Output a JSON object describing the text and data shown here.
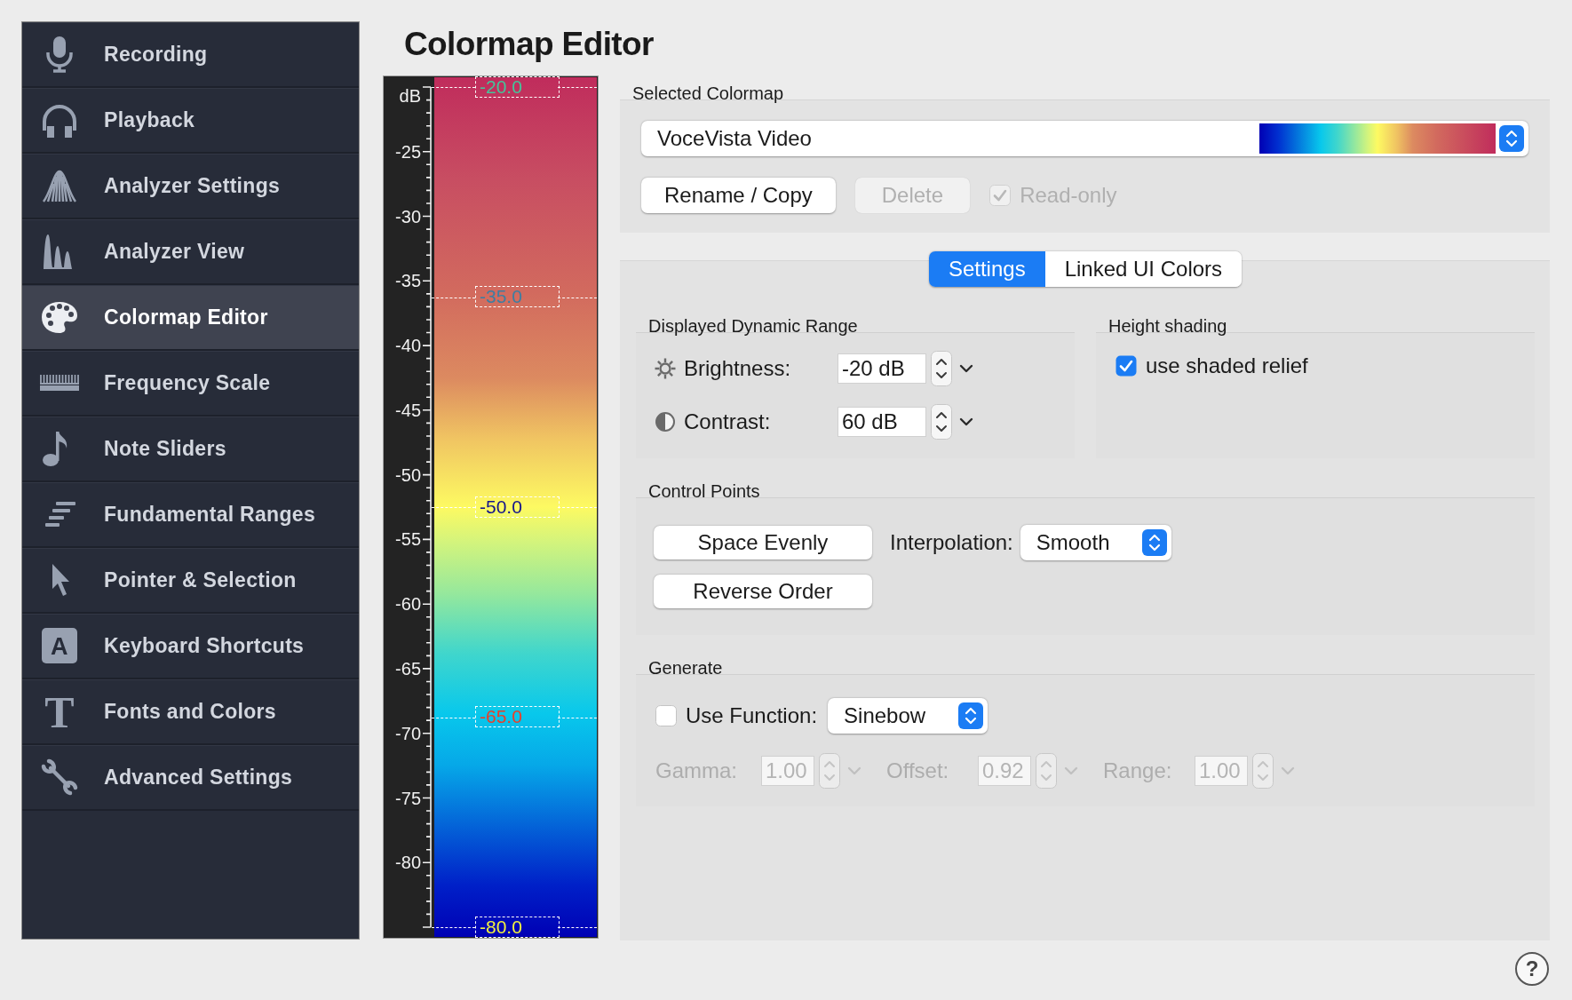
{
  "sidebar": {
    "items": [
      {
        "label": "Recording",
        "selected": false
      },
      {
        "label": "Playback",
        "selected": false
      },
      {
        "label": "Analyzer Settings",
        "selected": false
      },
      {
        "label": "Analyzer View",
        "selected": false
      },
      {
        "label": "Colormap Editor",
        "selected": true
      },
      {
        "label": "Frequency Scale",
        "selected": false
      },
      {
        "label": "Note Sliders",
        "selected": false
      },
      {
        "label": "Fundamental Ranges",
        "selected": false
      },
      {
        "label": "Pointer & Selection",
        "selected": false
      },
      {
        "label": "Keyboard Shortcuts",
        "selected": false,
        "icon_letter": "A"
      },
      {
        "label": "Fonts and Colors",
        "selected": false,
        "icon_letter": "T"
      },
      {
        "label": "Advanced Settings",
        "selected": false
      }
    ]
  },
  "title": "Colormap Editor",
  "colorbar": {
    "unit": "dB",
    "scale_labels": [
      "-25",
      "-30",
      "-35",
      "-40",
      "-45",
      "-50",
      "-55",
      "-60",
      "-65",
      "-70",
      "-75",
      "-80"
    ],
    "control_points": [
      {
        "label": "-20.0",
        "color": "#45c49a"
      },
      {
        "label": "-35.0",
        "color": "#3d7ea2"
      },
      {
        "label": "-50.0",
        "color": "#14148c"
      },
      {
        "label": "-65.0",
        "color": "#e8402a"
      },
      {
        "label": "-80.0",
        "color": "#f2f040"
      }
    ]
  },
  "selected_colormap": {
    "heading": "Selected Colormap",
    "value": "VoceVista Video",
    "buttons": [
      {
        "label": "Rename / Copy",
        "disabled": false
      },
      {
        "label": "Delete",
        "disabled": true
      }
    ],
    "read_only": {
      "label": "Read-only",
      "checked": true,
      "disabled": true
    }
  },
  "tabs": [
    {
      "label": "Settings",
      "selected": true
    },
    {
      "label": "Linked UI Colors",
      "selected": false
    }
  ],
  "dynamic_range": {
    "heading": "Displayed Dynamic Range",
    "rows": [
      {
        "label": "Brightness:",
        "value": "-20 dB"
      },
      {
        "label": "Contrast:",
        "value": "60 dB"
      }
    ]
  },
  "height_shading": {
    "heading": "Height shading",
    "checkbox": {
      "label": "use shaded relief",
      "checked": true
    }
  },
  "control_points": {
    "heading": "Control Points",
    "buttons": [
      "Space Evenly",
      "Reverse Order"
    ],
    "interpolation": {
      "label": "Interpolation:",
      "value": "Smooth"
    }
  },
  "generate": {
    "heading": "Generate",
    "use_function": {
      "label": "Use Function:",
      "checked": false
    },
    "function": {
      "value": "Sinebow"
    },
    "parameters": [
      {
        "label": "Gamma:",
        "value": "1.00",
        "disabled": true
      },
      {
        "label": "Offset:",
        "value": "0.92",
        "disabled": true
      },
      {
        "label": "Range:",
        "value": "1.00",
        "disabled": true
      }
    ]
  },
  "help_button": "?"
}
